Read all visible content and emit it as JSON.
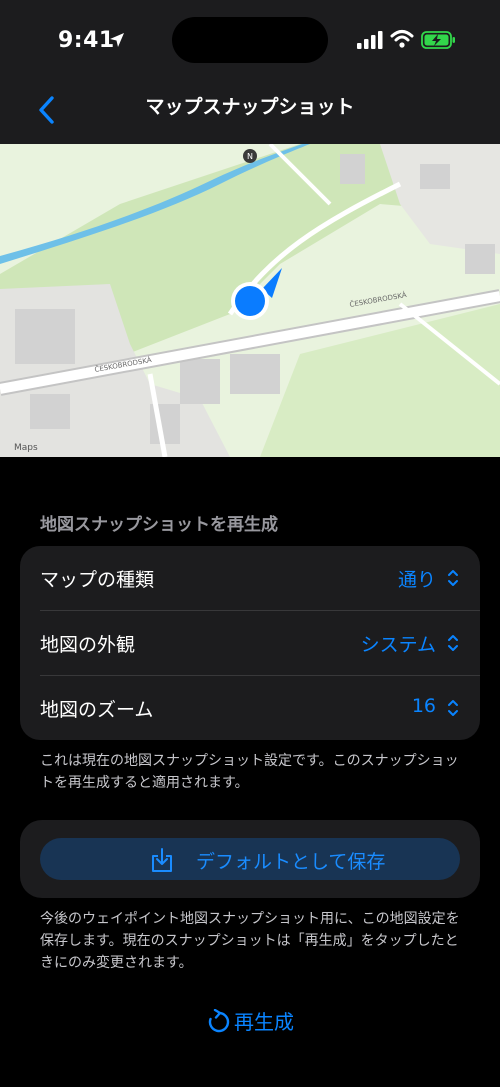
{
  "status_bar": {
    "time": "9:41"
  },
  "nav": {
    "back_icon": "chevron-left-icon",
    "title": "マップスナップショット"
  },
  "map": {
    "attribution": "Maps",
    "compass": "N",
    "street_labels": [
      "ČESKOBRODSKÁ",
      "ČESKOBRODSKÁ"
    ],
    "colors": {
      "land": "#e9f3de",
      "park": "#cfe6b8",
      "river": "#6ec0e8",
      "road": "#ffffff",
      "building": "#d4d4d4",
      "marker": "#0a7cff"
    }
  },
  "section": {
    "header": "地図スナップショットを再生成"
  },
  "settings": {
    "rows": [
      {
        "label": "マップの種類",
        "value": "通り"
      },
      {
        "label": "地図の外観",
        "value": "システム"
      },
      {
        "label": "地図のズーム",
        "value": "16"
      }
    ]
  },
  "notes": {
    "settings_note": "これは現在の地図スナップショット設定です。このスナップショットを再生成すると適用されます。",
    "save_note": "今後のウェイポイント地図スナップショット用に、この地図設定を保存します。現在のスナップショットは「再生成」をタップしたときにのみ変更されます。"
  },
  "actions": {
    "save_default": "デフォルトとして保存",
    "regenerate": "再生成"
  },
  "theme": {
    "accent": "#0a84ff",
    "background": "#000000",
    "card": "#1c1c1e"
  }
}
